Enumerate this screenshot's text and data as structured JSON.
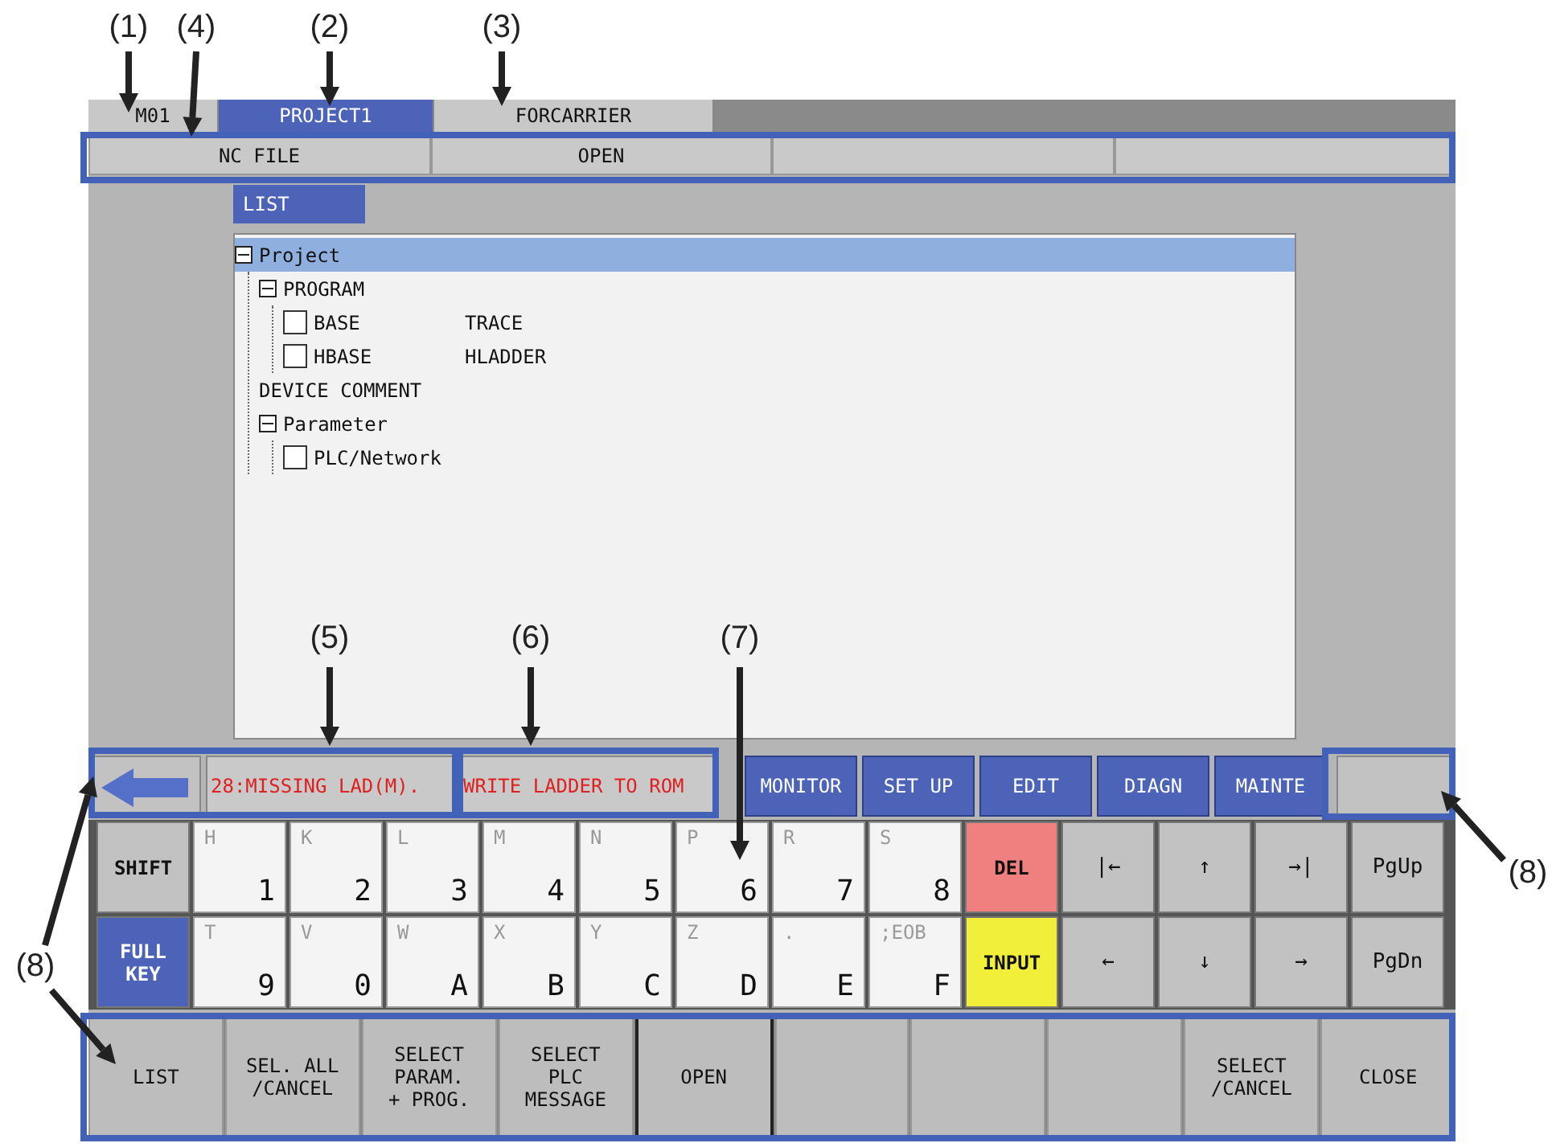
{
  "callouts": [
    {
      "label": "(1)"
    },
    {
      "label": "(4)"
    },
    {
      "label": "(2)"
    },
    {
      "label": "(3)"
    },
    {
      "label": "(5)"
    },
    {
      "label": "(6)"
    },
    {
      "label": "(7)"
    },
    {
      "label": "(8)"
    },
    {
      "label": "(8)"
    }
  ],
  "tabs": [
    {
      "label": "M01",
      "selected": false
    },
    {
      "label": "PROJECT1",
      "selected": true
    },
    {
      "label": "FORCARRIER",
      "selected": false
    }
  ],
  "menu": [
    {
      "label": "NC FILE"
    },
    {
      "label": "OPEN"
    }
  ],
  "list_tab": {
    "label": "LIST"
  },
  "tree": [
    {
      "label": "Project",
      "expanded": true,
      "selected": true,
      "children": [
        {
          "label": "PROGRAM",
          "expanded": true,
          "selected": false,
          "children": [
            {
              "label": "BASE",
              "checked": false,
              "column_2": "TRACE",
              "selected": false
            },
            {
              "label": "HBASE",
              "checked": false,
              "column_2": "HLADDER",
              "selected": false
            }
          ]
        },
        {
          "label": "DEVICE COMMENT",
          "selected": false
        },
        {
          "label": "Parameter",
          "expanded": true,
          "selected": false,
          "children": [
            {
              "label": "PLC/Network",
              "checked": false,
              "selected": false
            }
          ]
        }
      ]
    }
  ],
  "messages": [
    "28:MISSING LAD(M).",
    "WRITE LADDER TO ROM"
  ],
  "nav_tabs": [
    "MONITOR",
    "SET UP",
    "EDIT",
    "DIAGN",
    "MAINTE"
  ],
  "keys": [
    [
      {
        "kind": "toggle",
        "label": "SHIFT",
        "on": false
      },
      {
        "kind": "char",
        "sub": "H",
        "main": "1"
      },
      {
        "kind": "char",
        "sub": "K",
        "main": "2"
      },
      {
        "kind": "char",
        "sub": "L",
        "main": "3"
      },
      {
        "kind": "char",
        "sub": "M",
        "main": "4"
      },
      {
        "kind": "char",
        "sub": "N",
        "main": "5"
      },
      {
        "kind": "char",
        "sub": "P",
        "main": "6"
      },
      {
        "kind": "char",
        "sub": "R",
        "main": "7"
      },
      {
        "kind": "char",
        "sub": "S",
        "main": "8"
      },
      {
        "kind": "del",
        "label": "DEL"
      },
      {
        "kind": "nav",
        "label": "|←"
      },
      {
        "kind": "nav",
        "label": "↑"
      },
      {
        "kind": "nav",
        "label": "→|"
      },
      {
        "kind": "nav",
        "label": "PgUp"
      }
    ],
    [
      {
        "kind": "toggle",
        "label": "FULL KEY",
        "on": true
      },
      {
        "kind": "char",
        "sub": "T",
        "main": "9"
      },
      {
        "kind": "char",
        "sub": "V",
        "main": "0"
      },
      {
        "kind": "char",
        "sub": "W",
        "main": "A"
      },
      {
        "kind": "char",
        "sub": "X",
        "main": "B"
      },
      {
        "kind": "char",
        "sub": "Y",
        "main": "C"
      },
      {
        "kind": "char",
        "sub": "Z",
        "main": "D"
      },
      {
        "kind": "char",
        "sub": ".",
        "main": "E"
      },
      {
        "kind": "char",
        "sub": ";EOB",
        "main": "F"
      },
      {
        "kind": "input",
        "label": "INPUT"
      },
      {
        "kind": "nav",
        "label": "←"
      },
      {
        "kind": "nav",
        "label": "↓"
      },
      {
        "kind": "nav",
        "label": "→"
      },
      {
        "kind": "nav",
        "label": "PgDn"
      }
    ]
  ],
  "function_keys": [
    {
      "label": "LIST",
      "selected": false
    },
    {
      "label": "SEL. ALL\n/CANCEL",
      "selected": false
    },
    {
      "label": "SELECT\nPARAM.\n+ PROG.",
      "selected": false
    },
    {
      "label": "SELECT\nPLC\nMESSAGE",
      "selected": false
    },
    {
      "label": "OPEN",
      "selected": true
    },
    {
      "selected": false
    },
    {
      "selected": false
    },
    {
      "selected": false
    },
    {
      "label": "SELECT\n/CANCEL",
      "selected": false
    },
    {
      "label": "CLOSE",
      "selected": false
    }
  ]
}
